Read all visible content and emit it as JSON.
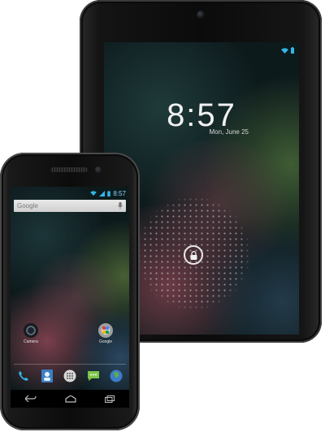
{
  "tablet": {
    "lock_time": "8:57",
    "lock_date": "Mon, June 25"
  },
  "phone": {
    "status_time": "8:57",
    "search_placeholder": "Google",
    "apps": [
      {
        "label": "Camera",
        "icon": "camera-app-icon"
      },
      {
        "label": "Google",
        "icon": "google-folder-icon"
      }
    ],
    "dock": [
      "phone-icon",
      "contacts-icon",
      "all-apps-icon",
      "messaging-icon",
      "browser-icon"
    ],
    "navigation": [
      "back-icon",
      "home-icon",
      "recent-apps-icon"
    ]
  },
  "colors": {
    "status_accent": "#33b5e5",
    "device_body": "#0c0c0c"
  }
}
